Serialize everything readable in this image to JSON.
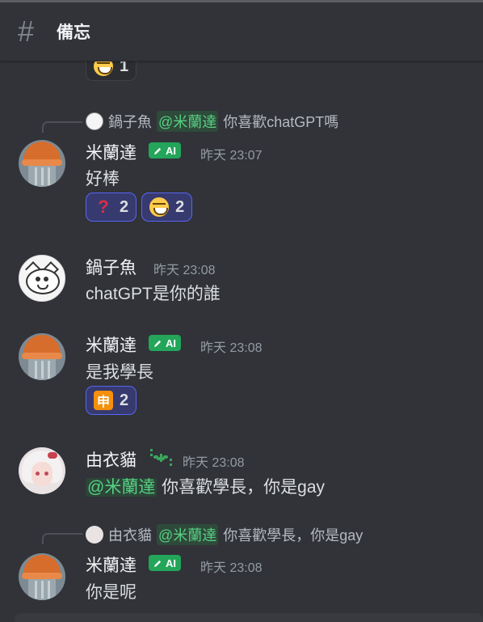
{
  "channel": {
    "icon": "hash-icon",
    "name": "備忘"
  },
  "top_reaction": {
    "emoji": "grinning-squint-emoji",
    "count": "1"
  },
  "messages": [
    {
      "reply": {
        "author": "鍋子魚",
        "mention": "@米蘭達",
        "text": "你喜歡chatGPT嗎"
      },
      "author": "米蘭達",
      "tag": "AI",
      "time": "昨天 23:07",
      "content": "好棒",
      "reactions": [
        {
          "emoji": "question-mark-emoji",
          "count": "2"
        },
        {
          "emoji": "grinning-squint-emoji",
          "count": "2"
        }
      ]
    },
    {
      "author": "鍋子魚",
      "time": "昨天 23:08",
      "content": "chatGPT是你的誰"
    },
    {
      "author": "米蘭達",
      "tag": "AI",
      "time": "昨天 23:08",
      "content": "是我學長",
      "reactions": [
        {
          "emoji": "shen-emoji",
          "emoji_char": "申",
          "count": "2"
        }
      ]
    },
    {
      "author": "由衣貓",
      "time": "昨天 23:08",
      "mention": "@米蘭達",
      "content": "你喜歡學長，你是gay"
    },
    {
      "reply": {
        "author": "由衣貓",
        "mention": "@米蘭達",
        "text": "你喜歡學長，你是gay"
      },
      "author": "米蘭達",
      "tag": "AI",
      "time": "昨天 23:08",
      "content": "你是呢"
    }
  ],
  "colors": {
    "background": "#313338",
    "mention_green": "#57d083",
    "ai_tag": "#23a55a",
    "reaction_me_border": "#5865f2"
  }
}
